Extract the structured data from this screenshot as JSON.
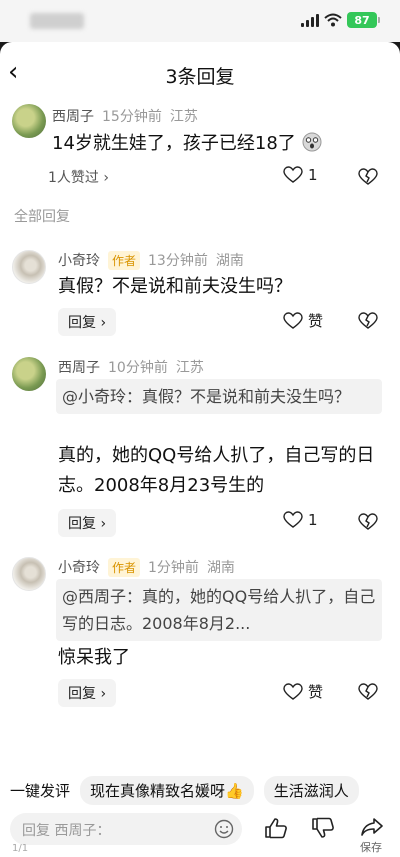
{
  "status": {
    "battery": "87"
  },
  "header": {
    "title": "3条回复"
  },
  "root": {
    "name": "西周子",
    "time": "15分钟前",
    "location": "江苏",
    "text": "14岁就生娃了，孩子已经18了",
    "likes_summary": "1人赞过 ›",
    "like_count": "1"
  },
  "section_label": "全部回复",
  "replies": [
    {
      "name": "小奇玲",
      "tag": "作者",
      "time": "13分钟前",
      "location": "湖南",
      "quote": "",
      "text": "真假？不是说和前夫没生吗？",
      "reply_label": "回复 ›",
      "like_label": "赞"
    },
    {
      "name": "西周子",
      "tag": "",
      "time": "10分钟前",
      "location": "江苏",
      "quote": "@小奇玲：真假？不是说和前夫没生吗？",
      "text": "真的，她的QQ号给人扒了，自己写的日志。2008年8月23号生的",
      "reply_label": "回复 ›",
      "like_label": "1"
    },
    {
      "name": "小奇玲",
      "tag": "作者",
      "time": "1分钟前",
      "location": "湖南",
      "quote": "@西周子：真的，她的QQ号给人扒了，自己写的日志。2008年8月2...",
      "text": "惊呆我了",
      "reply_label": "回复 ›",
      "like_label": "赞"
    }
  ],
  "bottom_tags": [
    "一键发评",
    "现在真像精致名媛呀👍",
    "生活滋润人"
  ],
  "input": {
    "placeholder": "回复 西周子："
  },
  "save_label": "保存",
  "page_indicator": "1/1"
}
